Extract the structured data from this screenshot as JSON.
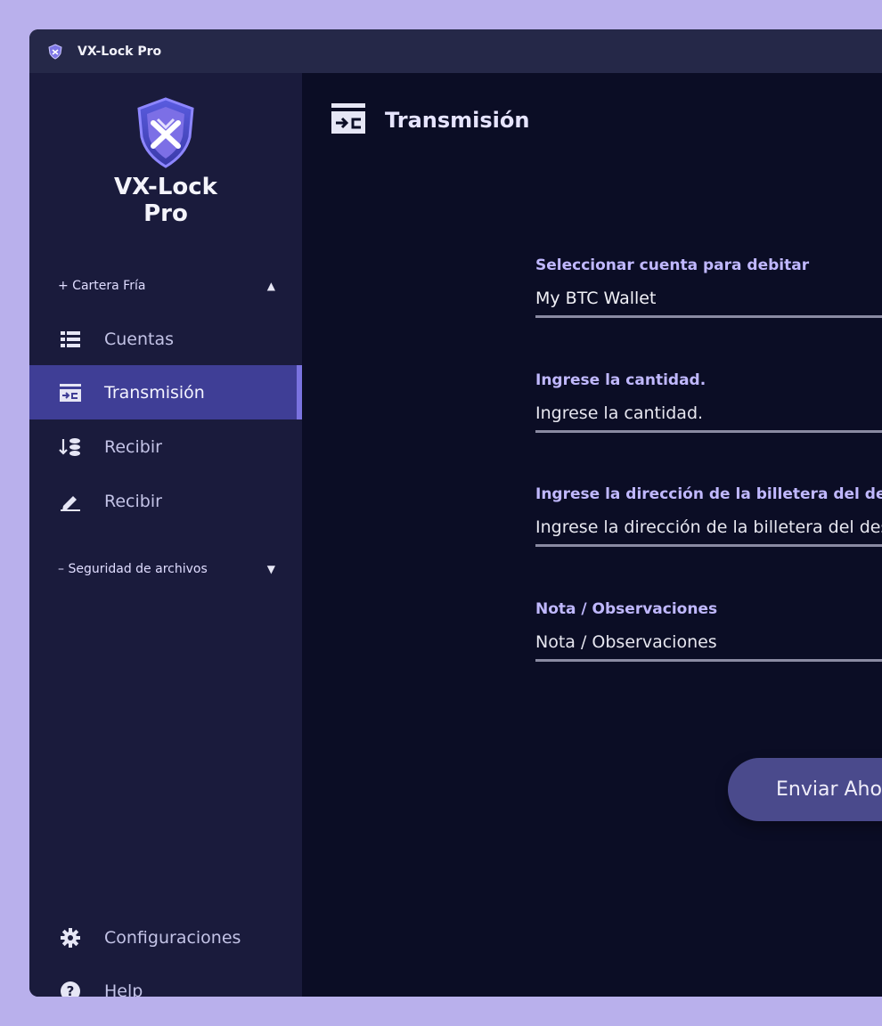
{
  "window": {
    "title": "VX-Lock Pro"
  },
  "brand": {
    "line1": "VX-Lock",
    "line2": "Pro"
  },
  "sidebar": {
    "sections": [
      {
        "label": "+ Cartera Fría",
        "caret": "▲"
      },
      {
        "label": "– Seguridad de archivos",
        "caret": "▼"
      }
    ],
    "items": [
      {
        "label": "Cuentas",
        "icon": "list-icon"
      },
      {
        "label": "Transmisión",
        "icon": "transfer-icon",
        "active": true
      },
      {
        "label": "Recibir",
        "icon": "receive-coins-icon"
      },
      {
        "label": "Recibir",
        "icon": "pen-icon"
      }
    ],
    "bottom": [
      {
        "label": "Configuraciones",
        "icon": "gear-icon"
      },
      {
        "label": "Help",
        "icon": "help-icon"
      }
    ]
  },
  "main": {
    "title": "Transmisión",
    "fields": [
      {
        "label": "Seleccionar cuenta para debitar",
        "value": "My BTC Wallet",
        "placeholder": ""
      },
      {
        "label": "Ingrese la cantidad.",
        "value": "",
        "placeholder": "Ingrese la cantidad."
      },
      {
        "label": "Ingrese la dirección de la billetera del destinatario",
        "value": "",
        "placeholder": "Ingrese la dirección de la billetera del destinatario"
      },
      {
        "label": "Nota / Observaciones",
        "value": "",
        "placeholder": "Nota / Observaciones"
      }
    ],
    "send_button": "Enviar Ahora"
  },
  "colors": {
    "accent": "#7a73e0",
    "active_bg": "#3f3e96",
    "label": "#c0b8ff",
    "background": "#0b0d25",
    "sidebar": "#1a1b3c"
  }
}
